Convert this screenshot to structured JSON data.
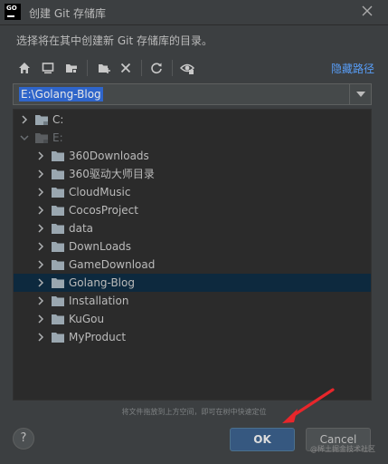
{
  "window": {
    "app_icon_text": "GO",
    "title": "创建 Git 存储库",
    "close_icon": "close-icon"
  },
  "description": "选择将在其中创建新 Git 存储库的目录。",
  "toolbar": {
    "icons": [
      "home-icon",
      "desktop-icon",
      "project-folder-icon",
      "new-folder-icon",
      "delete-icon",
      "refresh-icon",
      "show-hidden-icon"
    ],
    "hide_path_link": "隐藏路径"
  },
  "path_input": {
    "value": "E:\\Golang-Blog"
  },
  "tree": {
    "nodes": [
      {
        "label": "C:",
        "depth": 0,
        "expanded": false,
        "dim": false,
        "selected": false,
        "drive": true
      },
      {
        "label": "E:",
        "depth": 0,
        "expanded": true,
        "dim": true,
        "selected": false,
        "drive": true
      },
      {
        "label": "360Downloads",
        "depth": 1,
        "expanded": false,
        "dim": false,
        "selected": false,
        "drive": false
      },
      {
        "label": "360驱动大师目录",
        "depth": 1,
        "expanded": false,
        "dim": false,
        "selected": false,
        "drive": false
      },
      {
        "label": "CloudMusic",
        "depth": 1,
        "expanded": false,
        "dim": false,
        "selected": false,
        "drive": false
      },
      {
        "label": "CocosProject",
        "depth": 1,
        "expanded": false,
        "dim": false,
        "selected": false,
        "drive": false
      },
      {
        "label": "data",
        "depth": 1,
        "expanded": false,
        "dim": false,
        "selected": false,
        "drive": false
      },
      {
        "label": "DownLoads",
        "depth": 1,
        "expanded": false,
        "dim": false,
        "selected": false,
        "drive": false
      },
      {
        "label": "GameDownload",
        "depth": 1,
        "expanded": false,
        "dim": false,
        "selected": false,
        "drive": false
      },
      {
        "label": "Golang-Blog",
        "depth": 1,
        "expanded": false,
        "dim": false,
        "selected": true,
        "drive": false
      },
      {
        "label": "Installation",
        "depth": 1,
        "expanded": false,
        "dim": false,
        "selected": false,
        "drive": false
      },
      {
        "label": "KuGou",
        "depth": 1,
        "expanded": false,
        "dim": false,
        "selected": false,
        "drive": false
      },
      {
        "label": "MyProduct",
        "depth": 1,
        "expanded": false,
        "dim": false,
        "selected": false,
        "drive": false
      }
    ]
  },
  "drag_hint": "将文件拖放到上方空间，即可在树中快速定位",
  "buttons": {
    "help": "?",
    "ok": "OK",
    "cancel": "Cancel"
  },
  "watermark": "@稀土掘金技术社区",
  "colors": {
    "background": "#3c3f41",
    "tree_background": "#2b2b2b",
    "selection": "#0d293e",
    "link": "#589df6",
    "ok_button": "#365880",
    "annotation_arrow": "#e8262b"
  }
}
